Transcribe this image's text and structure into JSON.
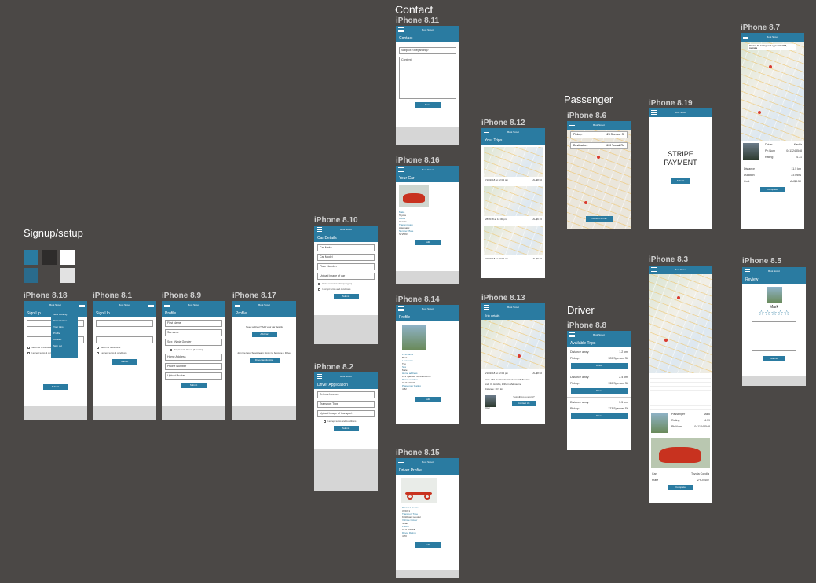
{
  "sections": {
    "contact": "Contact",
    "passenger": "Passenger",
    "signup": "Signup/setup",
    "driver": "Driver"
  },
  "app": {
    "title": "Boot Scoot"
  },
  "swatches": [
    "#2a7ba1",
    "#2e2c2b",
    "#ffffff",
    "#2a7ba1",
    "#ffffff"
  ],
  "phones": {
    "p818": {
      "label": "iPhone 8.18",
      "sub": "Sign Up",
      "menu": [
        "New booking",
        "Drive/Deliver",
        "Your trips",
        "Profile",
        "Contact",
        "Sign out"
      ],
      "chk1": "Send me occasional",
      "chk2": "I accept terms & conditions",
      "btn": "Submit"
    },
    "p81": {
      "label": "iPhone 8.1",
      "sub": "Sign Up",
      "chk1": "Send me occasional",
      "chk2": "I accept terms & conditions",
      "btn": "Submit"
    },
    "p89": {
      "label": "iPhone 8.9",
      "sub": "Profile",
      "fields": [
        "First Name",
        "Surname",
        "Sex: •Ninja Gender",
        "Home Address",
        "Phone Number",
        "Upload Avatar"
      ],
      "chk": "Only female drivers (if female)",
      "btn": "Submit"
    },
    "p817": {
      "label": "iPhone 8.17",
      "sub": "Profile",
      "text1": "Need a driver? Add your car details",
      "btn1": "Add car",
      "text2": "Join the Boot Scoot team: Apply to become a Driver",
      "btn2": "Driver application"
    },
    "p810": {
      "label": "iPhone 8.10",
      "sub": "Car Details",
      "fields": [
        "Car Make",
        "Car Model",
        "Plate Number",
        "Upload image of car"
      ],
      "chk1": "I have room for rides! (oregon)",
      "chk2": "I accept terms and conditions",
      "btn": "Submit"
    },
    "p82": {
      "label": "iPhone 8.2",
      "sub": "Driver Application",
      "fields": [
        "Drivers Licence",
        "Transport Type",
        "Upload image of transport"
      ],
      "chk": "I accept terms and conditions",
      "btn": "Submit"
    },
    "p811": {
      "label": "iPhone 8.11",
      "sub": "Contact",
      "subject": "Subject: <Regarding>",
      "content": "Content",
      "btn": "Send"
    },
    "p816": {
      "label": "iPhone 8.16",
      "sub": "Your Car",
      "info": [
        [
          "Make",
          "Toyota"
        ],
        [
          "Model",
          "Corolla"
        ],
        [
          "Transmission",
          "Automatic"
        ],
        [
          "Number Plate",
          "ST2983"
        ]
      ],
      "btn": "Edit"
    },
    "p814": {
      "label": "iPhone 8.14",
      "sub": "Profile",
      "info": [
        [
          "First name",
          "Brett"
        ],
        [
          "Last name",
          "Tito"
        ],
        [
          "Sex",
          "Male"
        ],
        [
          "Home address",
          "123 Spencer St, Melbourne"
        ],
        [
          "Phone number",
          "0411222333"
        ],
        [
          "Passenger Rating",
          "4.82"
        ]
      ],
      "btn": "Edit"
    },
    "p815": {
      "label": "iPhone 8.15",
      "sub": "Driver Profile",
      "info": [
        [
          "Drivers Licence",
          "376371"
        ],
        [
          "Transport Type",
          "Kickboard scooter"
        ],
        [
          "Vehicle Colour",
          "Small"
        ],
        [
          "Phone",
          "0411 230 58"
        ],
        [
          "Driver Rating",
          "4.70"
        ]
      ],
      "btn": "Edit"
    },
    "p812": {
      "label": "iPhone 8.12",
      "sub": "Your Trips",
      "trips": [
        [
          "2/10/2018 at 12:04 pm",
          "AU$8.50"
        ],
        [
          "5/8/2018 at 12:30 pm",
          "AU$6.70"
        ],
        [
          "4/10/2018 at 10:05 am",
          "AU$9.30"
        ]
      ]
    },
    "p813": {
      "label": "iPhone 8.13",
      "sub": "Trip details",
      "date": "6/10/2018 at 12:04 pm",
      "price": "AU$8.50",
      "start": "Start: 360 Docklands, Newtown, Melbourne",
      "end": "End: 31 Hutchs, Eltham Melbourne",
      "distance": "Distance: 10.9 km",
      "note": "Something go wrong?",
      "btn": "Contact Us",
      "driver": "Driver"
    },
    "p86": {
      "label": "iPhone 8.6",
      "pickup_label": "Pickup:",
      "pickup": "123 Spencer St",
      "dest_label": "Destination:",
      "dest": "600 Toorak Rd",
      "btn": "Confirm & Pay"
    },
    "p819": {
      "label": "iPhone 8.19",
      "payment": "STRIPE PAYMENT",
      "btn": "Submit"
    },
    "p87": {
      "label": "iPhone 8.7",
      "addr": "Flinders St, Collingwood Lygon VIC 3065, Australia",
      "info": [
        [
          "Driver",
          "Kashir"
        ],
        [
          "Ph Num",
          "0411243548"
        ],
        [
          "Rating",
          "4.71"
        ]
      ],
      "stats": [
        [
          "Distance",
          "11.5 km"
        ],
        [
          "Duration",
          "23 mins"
        ],
        [
          "Cost",
          "AU$8.50"
        ]
      ],
      "btn": "Complete"
    },
    "p88": {
      "label": "iPhone 8.8",
      "sub": "Available Trips",
      "trips": [
        [
          "Distance away:",
          "1.2 km",
          "Pickup:",
          "120 Spencer St"
        ],
        [
          "Distance away:",
          "2.4 km",
          "Pickup:",
          "130 Spencer St"
        ],
        [
          "Distance away:",
          "5.5 km",
          "Pickup:",
          "123 Spencer St"
        ]
      ],
      "btn": "Drive"
    },
    "p83": {
      "label": "iPhone 8.3",
      "info": [
        [
          "Passenger",
          "Mark"
        ],
        [
          "Rating",
          "4.79"
        ],
        [
          "Ph Num",
          "0411243548"
        ]
      ],
      "car": [
        [
          "Car",
          "Toyota Corolla"
        ],
        [
          "Plate",
          "ZYD4402"
        ]
      ],
      "btn": "Complete"
    },
    "p85": {
      "label": "iPhone 8.5",
      "sub": "Review",
      "name": "Mark",
      "stars": "☆☆☆☆☆",
      "btn": "Submit"
    }
  }
}
